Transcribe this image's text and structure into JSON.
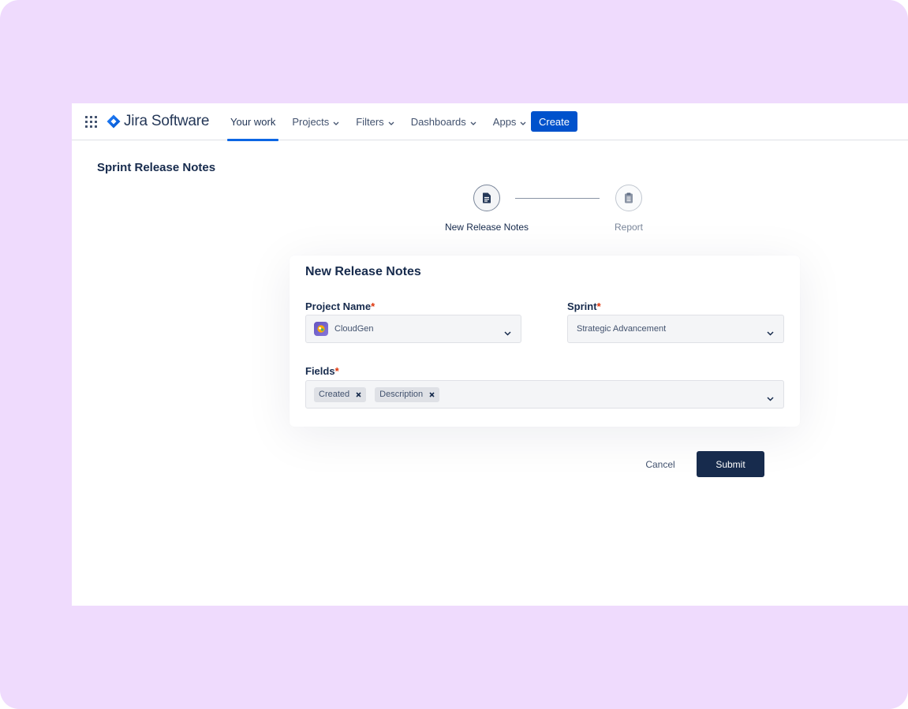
{
  "colors": {
    "canvas_background": "#efdbfd",
    "primary_blue": "#0052cc",
    "active_tab_underline": "#0c66e4",
    "submit_button": "#172b4d",
    "required_asterisk": "#de350b"
  },
  "header": {
    "app_switcher_icon": "grid-icon",
    "logo_icon": "jira-diamond-icon",
    "logo_text": "Jira Software",
    "nav": [
      {
        "label": "Your work",
        "active": true,
        "has_dropdown": false
      },
      {
        "label": "Projects",
        "active": false,
        "has_dropdown": true
      },
      {
        "label": "Filters",
        "active": false,
        "has_dropdown": true
      },
      {
        "label": "Dashboards",
        "active": false,
        "has_dropdown": true
      },
      {
        "label": "Apps",
        "active": false,
        "has_dropdown": true
      }
    ],
    "create_label": "Create"
  },
  "page": {
    "title": "Sprint Release Notes"
  },
  "stepper": {
    "steps": [
      {
        "label": "New Release Notes",
        "icon": "document-icon",
        "active": true
      },
      {
        "label": "Report",
        "icon": "clipboard-icon",
        "active": false
      }
    ]
  },
  "form": {
    "title": "New Release Notes",
    "project": {
      "label": "Project Name",
      "required_mark": "*",
      "value": "CloudGen",
      "icon": "project-avatar-icon"
    },
    "sprint": {
      "label": "Sprint",
      "required_mark": "*",
      "value": "Strategic Advancement"
    },
    "fields": {
      "label": "Fields",
      "required_mark": "*",
      "tags": [
        "Created",
        "Description"
      ]
    }
  },
  "actions": {
    "cancel_label": "Cancel",
    "submit_label": "Submit"
  }
}
